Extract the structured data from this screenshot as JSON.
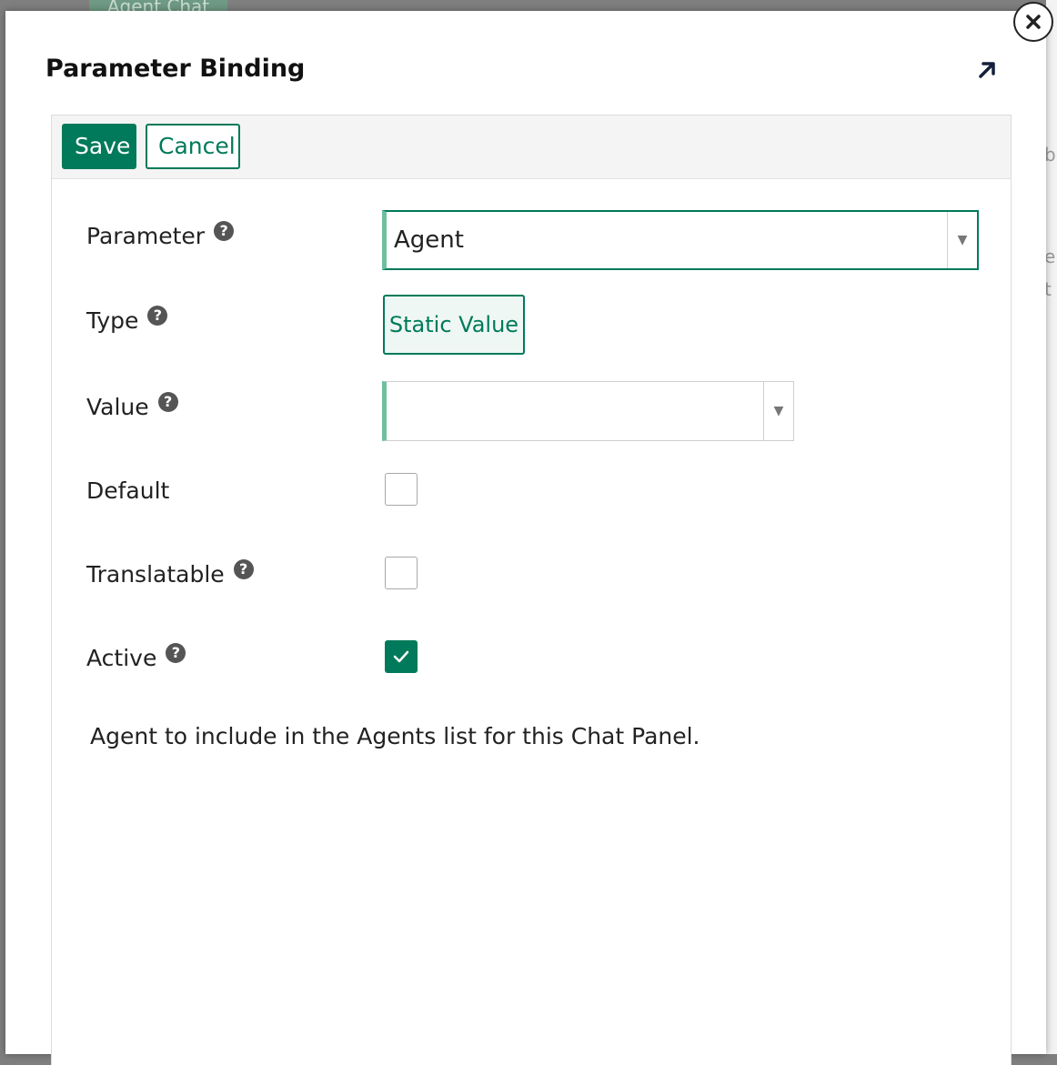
{
  "background": {
    "tab_label": "Agent Chat"
  },
  "modal": {
    "title": "Parameter Binding",
    "icons": {
      "expand": "expand-arrow-icon",
      "close": "close-icon"
    }
  },
  "toolbar": {
    "save_label": "Save",
    "cancel_label": "Cancel"
  },
  "form": {
    "parameter": {
      "label": "Parameter",
      "value": "Agent",
      "has_help": true
    },
    "type": {
      "label": "Type",
      "value": "Static Value",
      "has_help": true
    },
    "value": {
      "label": "Value",
      "value": "",
      "has_help": true
    },
    "default": {
      "label": "Default",
      "checked": false
    },
    "translatable": {
      "label": "Translatable",
      "checked": false,
      "has_help": true
    },
    "active": {
      "label": "Active",
      "checked": true,
      "has_help": true
    }
  },
  "description": "Agent to include in the Agents list for this Chat Panel.",
  "colors": {
    "accent": "#007a5a",
    "select_accent": "#6fbf9f",
    "help_icon": "#555555"
  }
}
